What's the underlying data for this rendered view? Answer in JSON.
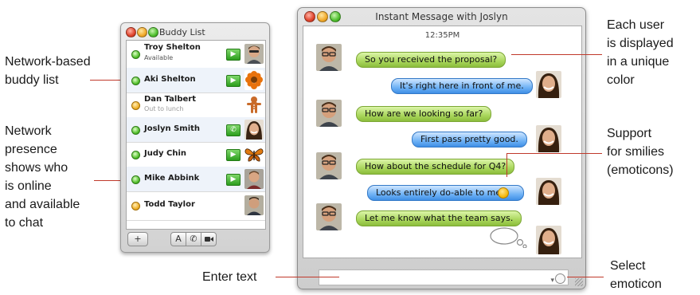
{
  "callouts": {
    "buddy_list": [
      "Network-based",
      "buddy list"
    ],
    "presence": [
      "Network",
      "presence",
      "shows who",
      "is online",
      "and available",
      "to chat"
    ],
    "colors": [
      "Each user",
      "is displayed",
      "in a unique",
      "color"
    ],
    "smilies": [
      "Support",
      "for smilies",
      "(emoticons)"
    ],
    "enter_text": "Enter text",
    "select_emoticon": [
      "Select",
      "emoticon"
    ]
  },
  "buddy_window": {
    "title": "Buddy List",
    "buddies": [
      {
        "name": "Troy Shelton",
        "status": "Available",
        "presence": "green",
        "capability": "video"
      },
      {
        "name": "Aki Shelton",
        "status": "",
        "presence": "green",
        "capability": "video"
      },
      {
        "name": "Dan Talbert",
        "status": "Out to lunch",
        "presence": "amber",
        "capability": ""
      },
      {
        "name": "Joslyn Smith",
        "status": "",
        "presence": "green",
        "capability": "phone"
      },
      {
        "name": "Judy Chin",
        "status": "",
        "presence": "green",
        "capability": "video"
      },
      {
        "name": "Mike Abbink",
        "status": "",
        "presence": "green",
        "capability": "video"
      },
      {
        "name": "Todd Taylor",
        "status": "",
        "presence": "amber",
        "capability": ""
      }
    ],
    "footer": {
      "add": "+",
      "text": "A",
      "audio": "phone-icon",
      "video": "camera-icon"
    }
  },
  "im_window": {
    "title": "Instant Message with Joslyn",
    "timestamp": "12:35PM",
    "messages": [
      {
        "from": "me",
        "text": "So you received the proposal?"
      },
      {
        "from": "them",
        "text": "It's right here in front of me."
      },
      {
        "from": "me",
        "text": "How are we looking so far?"
      },
      {
        "from": "them",
        "text": "First pass pretty good."
      },
      {
        "from": "me",
        "text": "How about the schedule for Q4?"
      },
      {
        "from": "them",
        "text": "Looks entirely do-able to me."
      },
      {
        "from": "me",
        "text": "Let me know what the team says."
      }
    ],
    "input_value": ""
  },
  "colors": {
    "my_bubble": "#a9d65c",
    "their_bubble": "#6fb2f5",
    "callout_line": "#c0392b"
  }
}
